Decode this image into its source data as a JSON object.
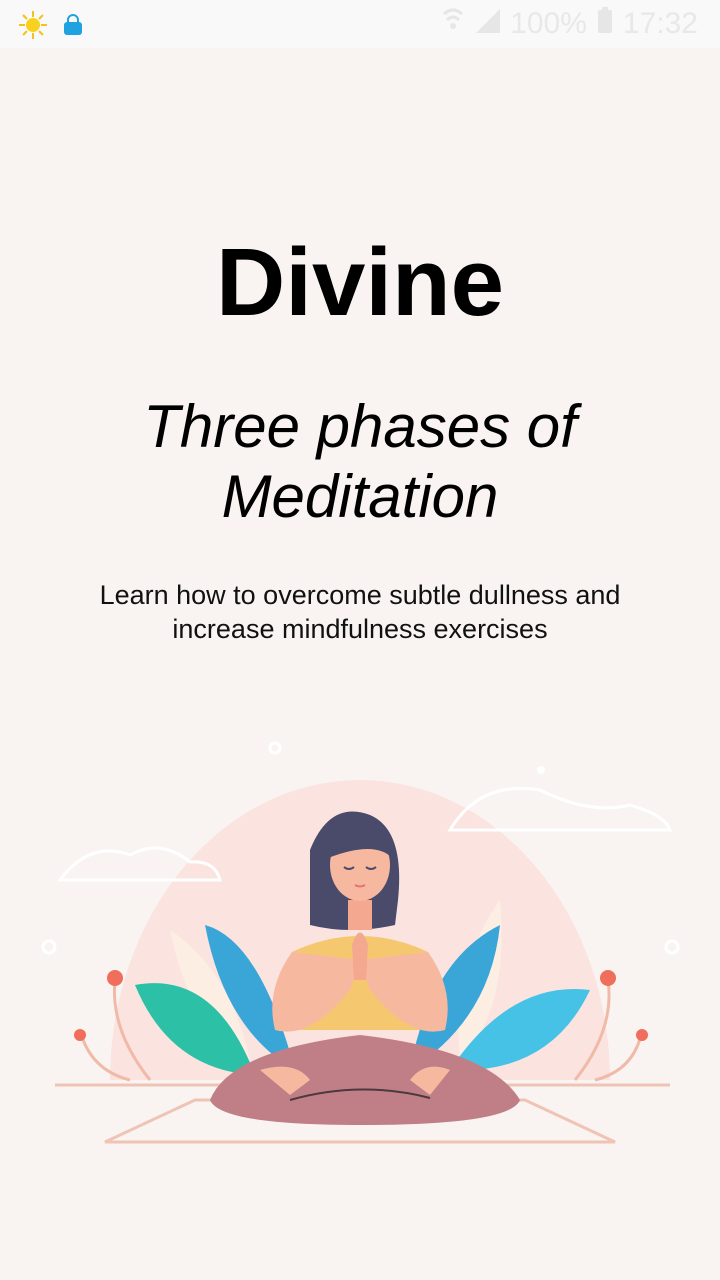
{
  "status": {
    "battery": "100%",
    "time": "17:32",
    "icons": [
      "sun-icon",
      "shopping-bag-icon",
      "wifi-icon",
      "signal-icon",
      "battery-icon"
    ]
  },
  "content": {
    "title": "Divine",
    "subtitle_line1": "Three phases of",
    "subtitle_line2": "Meditation",
    "description_line1": "Learn how to overcome subtle dullness and",
    "description_line2": "increase mindfulness exercises"
  },
  "colors": {
    "background": "#f9f4f1",
    "accent_teal": "#2cc0a6",
    "accent_blue": "#3aa6d8",
    "shirt": "#f5c86f",
    "pants": "#c07f86",
    "halo": "#fbe3df"
  }
}
